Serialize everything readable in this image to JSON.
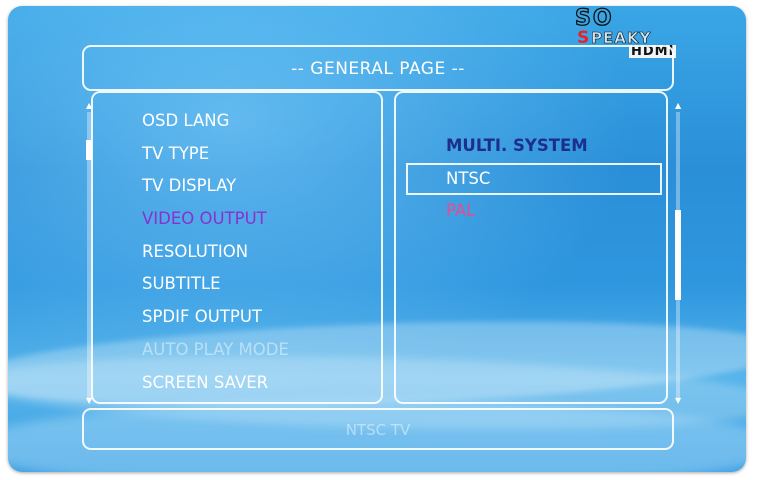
{
  "page": {
    "title": "-- GENERAL PAGE --",
    "status": "NTSC TV"
  },
  "logo": {
    "top": "SO",
    "brand_first_letter": "S",
    "brand_rest": "PEAKY",
    "hdmi": "HDMI"
  },
  "menu": {
    "items": [
      {
        "label": "OSD LANG",
        "state": "normal"
      },
      {
        "label": "TV TYPE",
        "state": "normal"
      },
      {
        "label": "TV DISPLAY",
        "state": "normal"
      },
      {
        "label": "VIDEO OUTPUT",
        "state": "current"
      },
      {
        "label": "RESOLUTION",
        "state": "normal"
      },
      {
        "label": "SUBTITLE",
        "state": "normal"
      },
      {
        "label": "SPDIF OUTPUT",
        "state": "normal"
      },
      {
        "label": "AUTO PLAY MODE",
        "state": "disabled"
      },
      {
        "label": "SCREEN SAVER",
        "state": "normal"
      }
    ]
  },
  "options": {
    "heading": "MULTI. SYSTEM",
    "items": [
      {
        "label": "NTSC",
        "state": "focused"
      },
      {
        "label": "PAL",
        "state": "selected"
      }
    ]
  },
  "colors": {
    "background": "#2a8fd8",
    "current_item": "#8a2fd0",
    "heading": "#1c2f8c",
    "selected_option": "#e84c8e",
    "logo_red": "#e6232a"
  },
  "icons": {
    "scroll_up": "scroll-up-arrow-icon",
    "scroll_down": "scroll-down-arrow-icon"
  }
}
